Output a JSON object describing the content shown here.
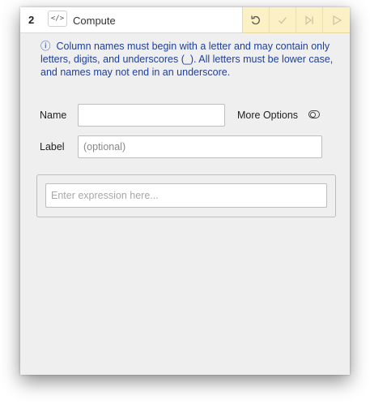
{
  "step": {
    "number": "2",
    "code_icon": "</>",
    "title": "Compute"
  },
  "actions": [
    {
      "name": "undo-icon",
      "enabled": true
    },
    {
      "name": "check-icon",
      "enabled": false
    },
    {
      "name": "step-forward-icon",
      "enabled": false
    },
    {
      "name": "play-icon",
      "enabled": false
    }
  ],
  "info": {
    "icon": "ⓘ",
    "text": "Column names must begin with a letter and may contain only letters, digits, and underscores (_). All letters must be lower case, and names may not end in an underscore."
  },
  "form": {
    "name_label": "Name",
    "name_value": "",
    "label_label": "Label",
    "label_placeholder": "(optional)",
    "more_options_label": "More Options",
    "more_options_enabled": false
  },
  "expression": {
    "placeholder": "Enter expression here..."
  },
  "colors": {
    "action_bar": "#fbf1c4",
    "info_text": "#1f3f9a",
    "card_bg": "#efefef"
  }
}
